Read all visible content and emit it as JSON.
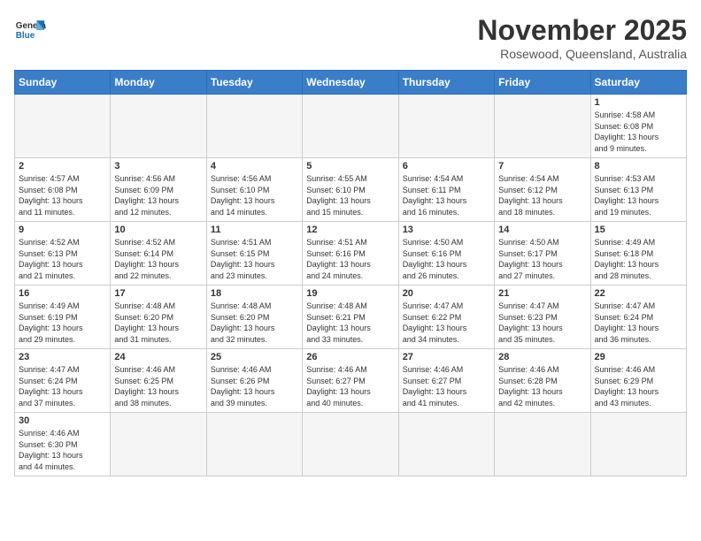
{
  "header": {
    "logo_general": "General",
    "logo_blue": "Blue",
    "month": "November 2025",
    "location": "Rosewood, Queensland, Australia"
  },
  "weekdays": [
    "Sunday",
    "Monday",
    "Tuesday",
    "Wednesday",
    "Thursday",
    "Friday",
    "Saturday"
  ],
  "weeks": [
    [
      {
        "day": "",
        "info": ""
      },
      {
        "day": "",
        "info": ""
      },
      {
        "day": "",
        "info": ""
      },
      {
        "day": "",
        "info": ""
      },
      {
        "day": "",
        "info": ""
      },
      {
        "day": "",
        "info": ""
      },
      {
        "day": "1",
        "info": "Sunrise: 4:58 AM\nSunset: 6:08 PM\nDaylight: 13 hours\nand 9 minutes."
      }
    ],
    [
      {
        "day": "2",
        "info": "Sunrise: 4:57 AM\nSunset: 6:08 PM\nDaylight: 13 hours\nand 11 minutes."
      },
      {
        "day": "3",
        "info": "Sunrise: 4:56 AM\nSunset: 6:09 PM\nDaylight: 13 hours\nand 12 minutes."
      },
      {
        "day": "4",
        "info": "Sunrise: 4:56 AM\nSunset: 6:10 PM\nDaylight: 13 hours\nand 14 minutes."
      },
      {
        "day": "5",
        "info": "Sunrise: 4:55 AM\nSunset: 6:10 PM\nDaylight: 13 hours\nand 15 minutes."
      },
      {
        "day": "6",
        "info": "Sunrise: 4:54 AM\nSunset: 6:11 PM\nDaylight: 13 hours\nand 16 minutes."
      },
      {
        "day": "7",
        "info": "Sunrise: 4:54 AM\nSunset: 6:12 PM\nDaylight: 13 hours\nand 18 minutes."
      },
      {
        "day": "8",
        "info": "Sunrise: 4:53 AM\nSunset: 6:13 PM\nDaylight: 13 hours\nand 19 minutes."
      }
    ],
    [
      {
        "day": "9",
        "info": "Sunrise: 4:52 AM\nSunset: 6:13 PM\nDaylight: 13 hours\nand 21 minutes."
      },
      {
        "day": "10",
        "info": "Sunrise: 4:52 AM\nSunset: 6:14 PM\nDaylight: 13 hours\nand 22 minutes."
      },
      {
        "day": "11",
        "info": "Sunrise: 4:51 AM\nSunset: 6:15 PM\nDaylight: 13 hours\nand 23 minutes."
      },
      {
        "day": "12",
        "info": "Sunrise: 4:51 AM\nSunset: 6:16 PM\nDaylight: 13 hours\nand 24 minutes."
      },
      {
        "day": "13",
        "info": "Sunrise: 4:50 AM\nSunset: 6:16 PM\nDaylight: 13 hours\nand 26 minutes."
      },
      {
        "day": "14",
        "info": "Sunrise: 4:50 AM\nSunset: 6:17 PM\nDaylight: 13 hours\nand 27 minutes."
      },
      {
        "day": "15",
        "info": "Sunrise: 4:49 AM\nSunset: 6:18 PM\nDaylight: 13 hours\nand 28 minutes."
      }
    ],
    [
      {
        "day": "16",
        "info": "Sunrise: 4:49 AM\nSunset: 6:19 PM\nDaylight: 13 hours\nand 29 minutes."
      },
      {
        "day": "17",
        "info": "Sunrise: 4:48 AM\nSunset: 6:20 PM\nDaylight: 13 hours\nand 31 minutes."
      },
      {
        "day": "18",
        "info": "Sunrise: 4:48 AM\nSunset: 6:20 PM\nDaylight: 13 hours\nand 32 minutes."
      },
      {
        "day": "19",
        "info": "Sunrise: 4:48 AM\nSunset: 6:21 PM\nDaylight: 13 hours\nand 33 minutes."
      },
      {
        "day": "20",
        "info": "Sunrise: 4:47 AM\nSunset: 6:22 PM\nDaylight: 13 hours\nand 34 minutes."
      },
      {
        "day": "21",
        "info": "Sunrise: 4:47 AM\nSunset: 6:23 PM\nDaylight: 13 hours\nand 35 minutes."
      },
      {
        "day": "22",
        "info": "Sunrise: 4:47 AM\nSunset: 6:24 PM\nDaylight: 13 hours\nand 36 minutes."
      }
    ],
    [
      {
        "day": "23",
        "info": "Sunrise: 4:47 AM\nSunset: 6:24 PM\nDaylight: 13 hours\nand 37 minutes."
      },
      {
        "day": "24",
        "info": "Sunrise: 4:46 AM\nSunset: 6:25 PM\nDaylight: 13 hours\nand 38 minutes."
      },
      {
        "day": "25",
        "info": "Sunrise: 4:46 AM\nSunset: 6:26 PM\nDaylight: 13 hours\nand 39 minutes."
      },
      {
        "day": "26",
        "info": "Sunrise: 4:46 AM\nSunset: 6:27 PM\nDaylight: 13 hours\nand 40 minutes."
      },
      {
        "day": "27",
        "info": "Sunrise: 4:46 AM\nSunset: 6:27 PM\nDaylight: 13 hours\nand 41 minutes."
      },
      {
        "day": "28",
        "info": "Sunrise: 4:46 AM\nSunset: 6:28 PM\nDaylight: 13 hours\nand 42 minutes."
      },
      {
        "day": "29",
        "info": "Sunrise: 4:46 AM\nSunset: 6:29 PM\nDaylight: 13 hours\nand 43 minutes."
      }
    ],
    [
      {
        "day": "30",
        "info": "Sunrise: 4:46 AM\nSunset: 6:30 PM\nDaylight: 13 hours\nand 44 minutes."
      },
      {
        "day": "",
        "info": ""
      },
      {
        "day": "",
        "info": ""
      },
      {
        "day": "",
        "info": ""
      },
      {
        "day": "",
        "info": ""
      },
      {
        "day": "",
        "info": ""
      },
      {
        "day": "",
        "info": ""
      }
    ]
  ]
}
